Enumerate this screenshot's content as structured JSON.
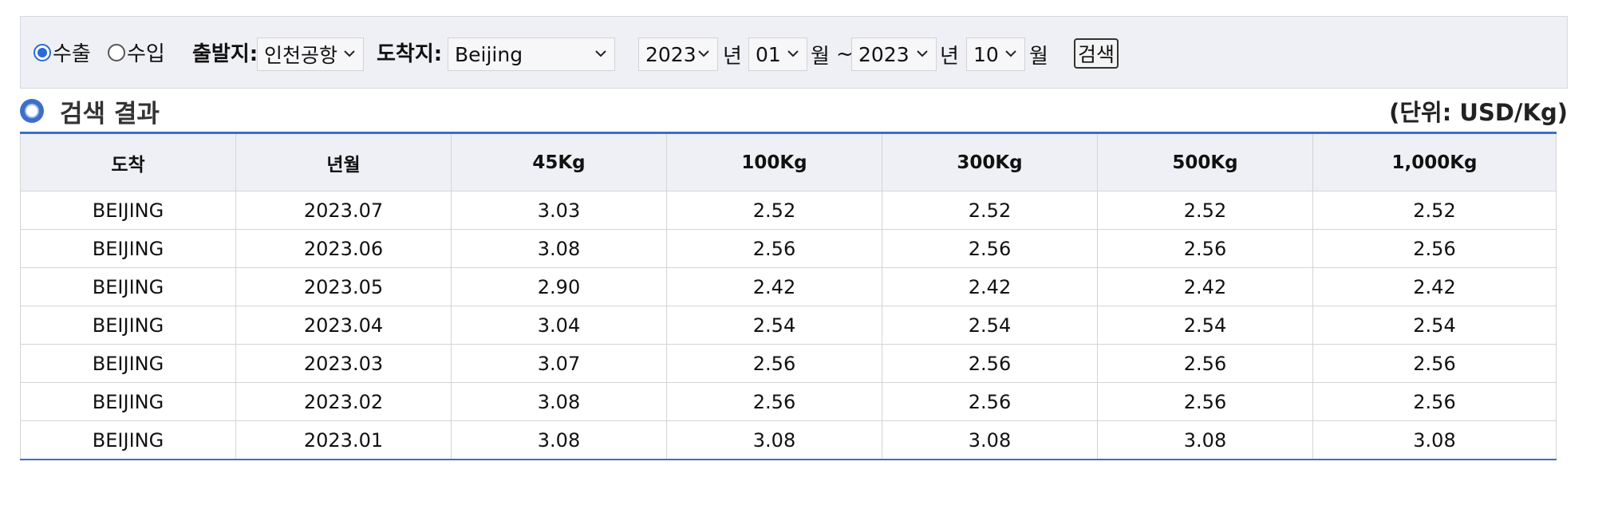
{
  "filters": {
    "radio_export_label": "수출",
    "radio_import_label": "수입",
    "origin_label": "출발지:",
    "origin_value": "인천공항",
    "dest_label": "도착지:",
    "dest_value": "Beijing",
    "from_year": "2023",
    "year_unit": "년",
    "from_month": "01",
    "month_unit": "월",
    "range_sep": "~",
    "to_year": "2023",
    "to_month": "10",
    "search_label": "검색"
  },
  "result": {
    "title": "검색 결과",
    "unit_note": "(단위: USD/Kg)"
  },
  "table": {
    "headers": [
      "도착",
      "년월",
      "45Kg",
      "100Kg",
      "300Kg",
      "500Kg",
      "1,000Kg"
    ],
    "rows": [
      [
        "BEIJING",
        "2023.07",
        "3.03",
        "2.52",
        "2.52",
        "2.52",
        "2.52"
      ],
      [
        "BEIJING",
        "2023.06",
        "3.08",
        "2.56",
        "2.56",
        "2.56",
        "2.56"
      ],
      [
        "BEIJING",
        "2023.05",
        "2.90",
        "2.42",
        "2.42",
        "2.42",
        "2.42"
      ],
      [
        "BEIJING",
        "2023.04",
        "3.04",
        "2.54",
        "2.54",
        "2.54",
        "2.54"
      ],
      [
        "BEIJING",
        "2023.03",
        "3.07",
        "2.56",
        "2.56",
        "2.56",
        "2.56"
      ],
      [
        "BEIJING",
        "2023.02",
        "3.08",
        "2.56",
        "2.56",
        "2.56",
        "2.56"
      ],
      [
        "BEIJING",
        "2023.01",
        "3.08",
        "3.08",
        "3.08",
        "3.08",
        "3.08"
      ]
    ]
  },
  "colors": {
    "accent": "#3d6ec9",
    "filter_bg": "#eff0f5",
    "header_bg": "#eef0f5"
  }
}
